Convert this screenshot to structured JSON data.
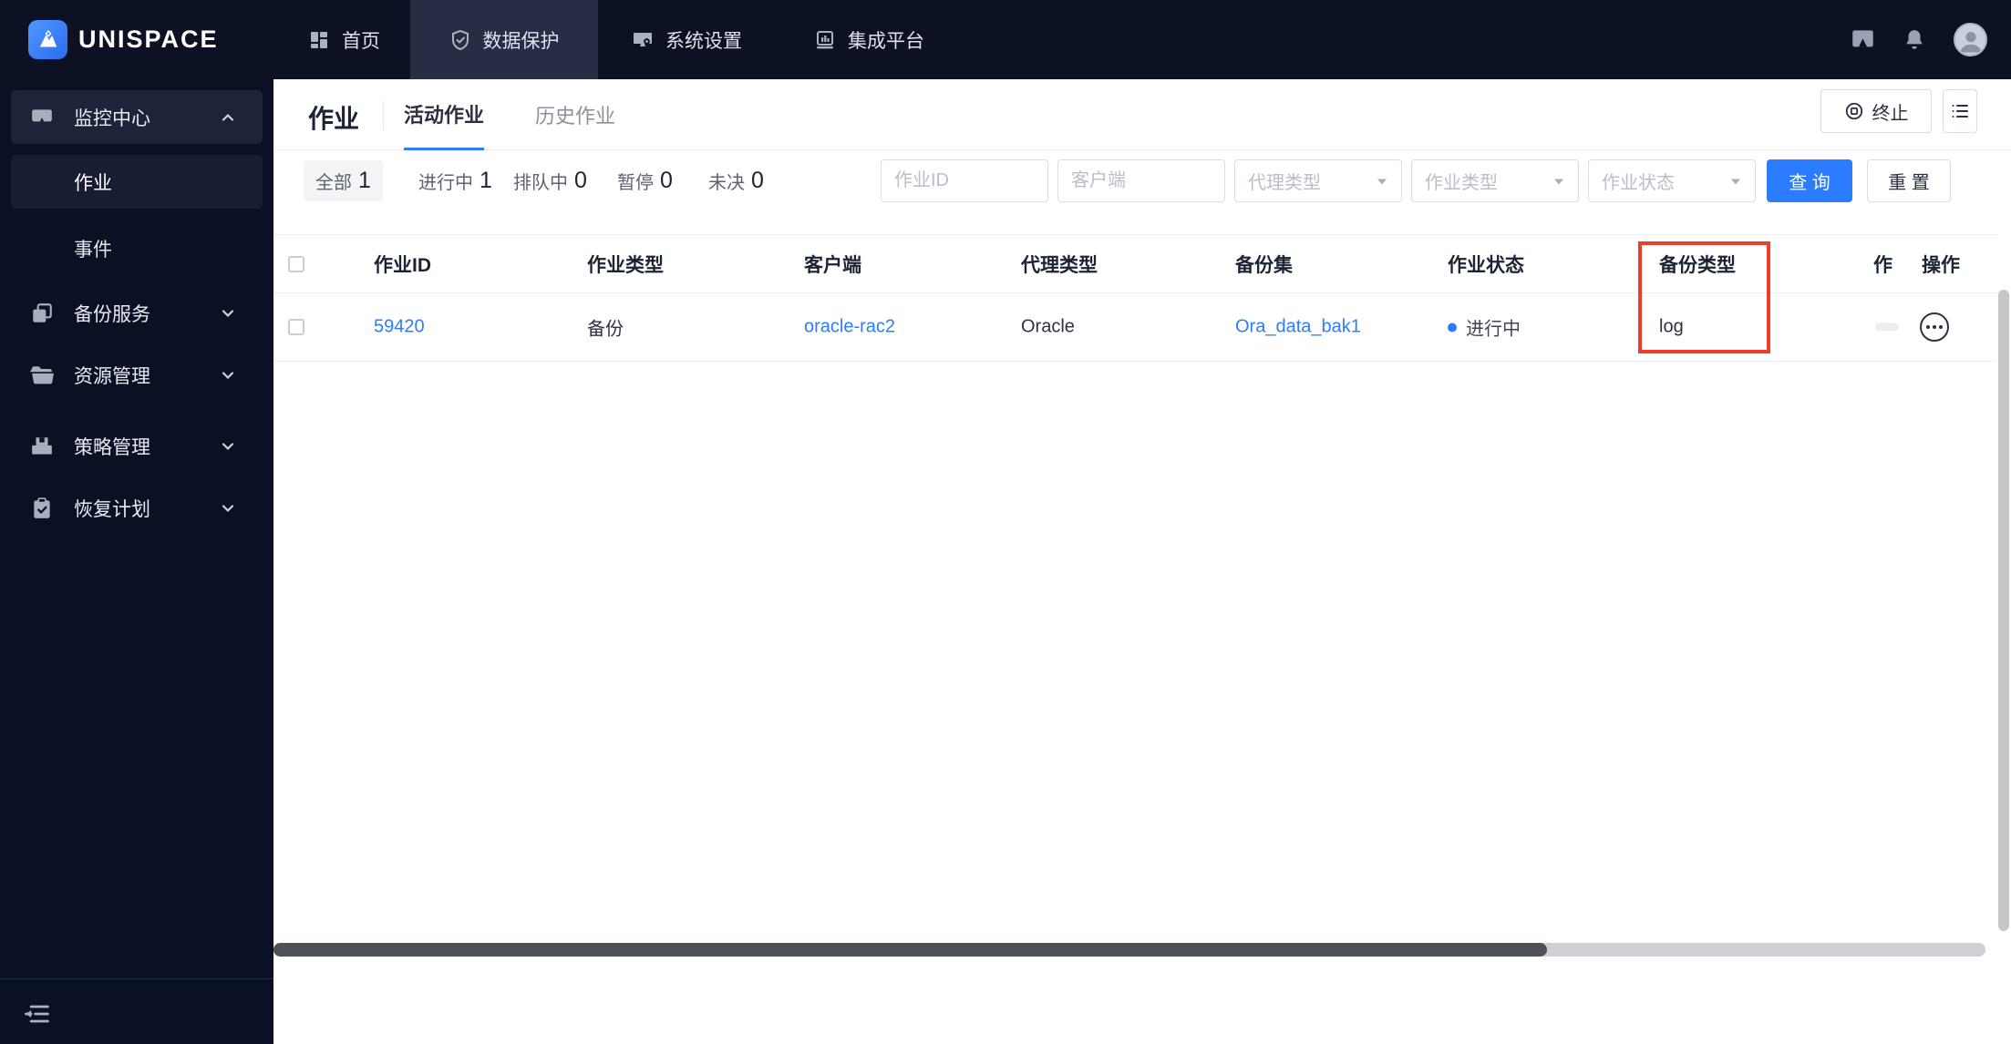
{
  "brand": {
    "name": "UNISPACE"
  },
  "topnav": {
    "items": [
      {
        "label": "首页",
        "icon": "dashboard-icon",
        "active": false
      },
      {
        "label": "数据保护",
        "icon": "shield-icon",
        "active": true
      },
      {
        "label": "系统设置",
        "icon": "monitor-gear-icon",
        "active": false
      },
      {
        "label": "集成平台",
        "icon": "chart-board-icon",
        "active": false
      }
    ],
    "right_icons": [
      "message-icon",
      "bell-icon",
      "avatar"
    ]
  },
  "sidebar": {
    "groups": [
      {
        "label": "监控中心",
        "icon": "monitor-chat-icon",
        "state": "expanded",
        "children": [
          {
            "label": "作业",
            "active": true
          },
          {
            "label": "事件",
            "active": false
          }
        ]
      },
      {
        "label": "备份服务",
        "icon": "copy-icon",
        "state": "collapsed"
      },
      {
        "label": "资源管理",
        "icon": "folder-icon",
        "state": "collapsed"
      },
      {
        "label": "策略管理",
        "icon": "device-icon",
        "state": "collapsed"
      },
      {
        "label": "恢复计划",
        "icon": "clipboard-check-icon",
        "state": "collapsed"
      }
    ]
  },
  "page": {
    "title": "作业",
    "tabs": [
      {
        "label": "活动作业",
        "active": true
      },
      {
        "label": "历史作业",
        "active": false
      }
    ],
    "actions": {
      "terminate": "终止"
    }
  },
  "filters": {
    "chips": [
      {
        "label": "全部",
        "count": "1",
        "selected": true
      },
      {
        "label": "进行中",
        "count": "1",
        "selected": false
      },
      {
        "label": "排队中",
        "count": "0",
        "selected": false
      },
      {
        "label": "暂停",
        "count": "0",
        "selected": false
      },
      {
        "label": "未决",
        "count": "0",
        "selected": false
      }
    ],
    "inputs": [
      {
        "placeholder": "作业ID",
        "value": ""
      },
      {
        "placeholder": "客户端",
        "value": ""
      }
    ],
    "selects": [
      {
        "placeholder": "代理类型"
      },
      {
        "placeholder": "作业类型"
      },
      {
        "placeholder": "作业状态"
      }
    ],
    "buttons": {
      "query": "查 询",
      "reset": "重 置"
    }
  },
  "table": {
    "columns": [
      "作业ID",
      "作业类型",
      "客户端",
      "代理类型",
      "备份集",
      "作业状态",
      "备份类型",
      "作",
      "操作"
    ],
    "rows": [
      {
        "job_id": "59420",
        "job_type": "备份",
        "client": "oracle-rac2",
        "agent_type": "Oracle",
        "backup_set": "Ora_data_bak1",
        "status": "进行中",
        "status_color": "#2b7cff",
        "backup_type": "log"
      }
    ]
  },
  "annotation": {
    "type": "red-box",
    "color": "#ef3c2d",
    "highlights_column": "备份类型"
  }
}
